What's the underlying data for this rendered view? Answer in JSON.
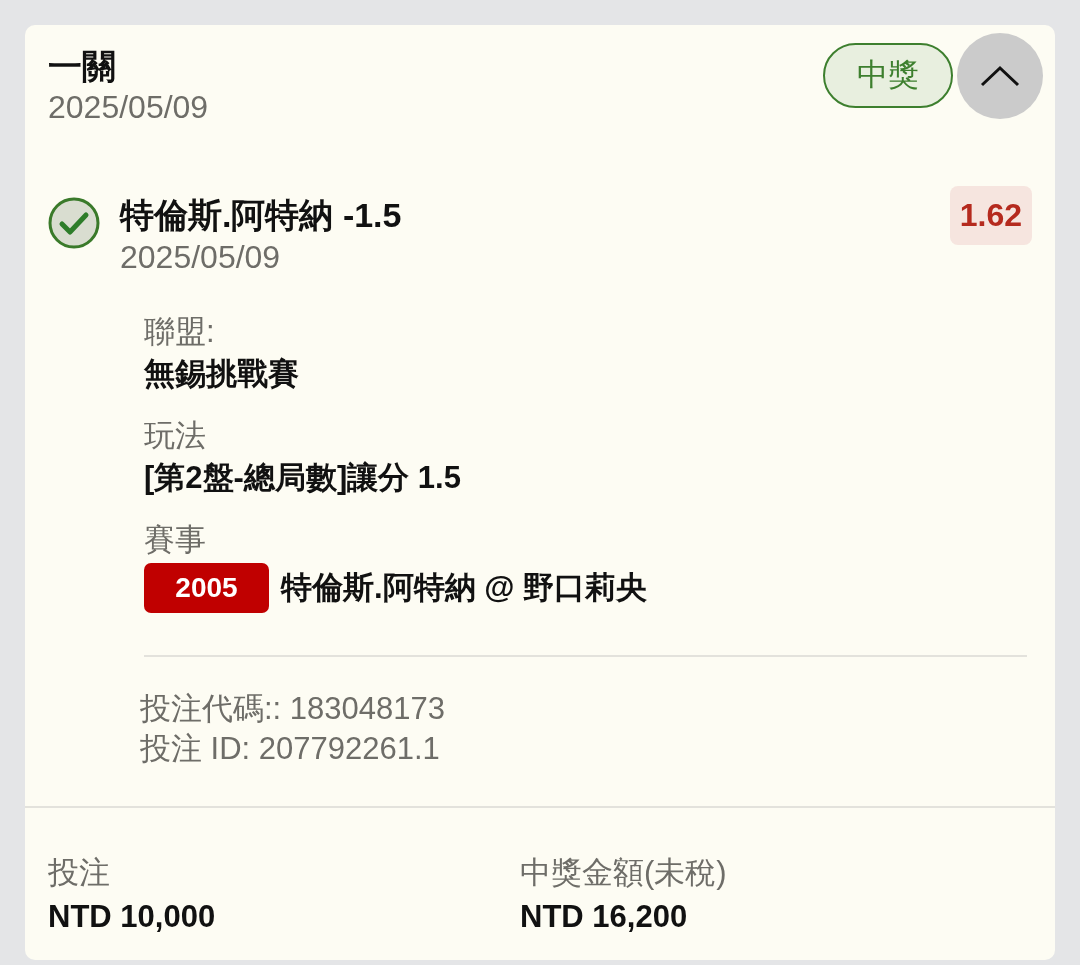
{
  "bet": {
    "title": "一關",
    "date": "2025/05/09",
    "status": {
      "label": "中獎",
      "kind": "won"
    },
    "expanded": true
  },
  "selection": {
    "won": true,
    "name": "特倫斯.阿特納 -1.5",
    "date": "2025/05/09",
    "odds": "1.62"
  },
  "details": [
    {
      "kind": "text",
      "label": "聯盟:",
      "value": "無錫挑戰賽"
    },
    {
      "kind": "text",
      "label": "玩法",
      "value": "[第2盤-總局數]讓分 1.5"
    },
    {
      "kind": "event",
      "label": "賽事",
      "event_code": "2005",
      "value": "特倫斯.阿特納 @ 野口莉央"
    }
  ],
  "references": [
    "投注代碼:: 183048173",
    "投注 ID: 207792261.1"
  ],
  "summary": [
    {
      "label": "投注",
      "value": "NTD 10,000"
    },
    {
      "label": "中獎金額(未稅)",
      "value": "NTD 16,200"
    }
  ]
}
